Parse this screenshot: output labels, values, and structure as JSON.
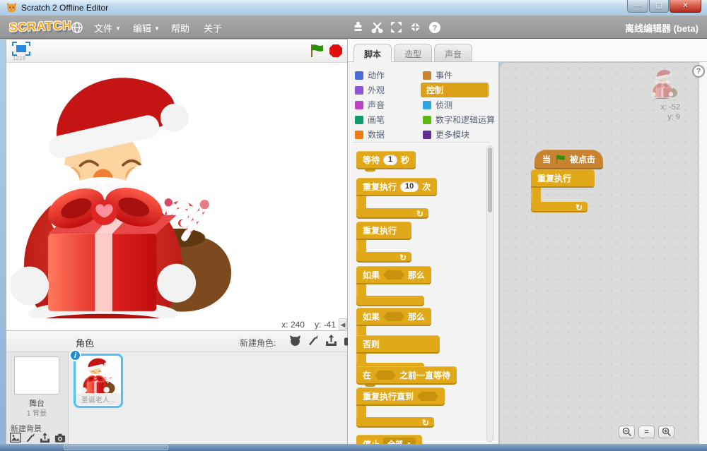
{
  "window": {
    "title": "Scratch 2 Offline Editor",
    "controls": {
      "minimize": "—",
      "maximize": "▢",
      "close": "✕"
    }
  },
  "menubar": {
    "logo": "SCRATCH",
    "file": "文件",
    "edit": "编辑",
    "help": "帮助",
    "about": "关于",
    "arrow": "▼",
    "right_label": "离线编辑器 (beta)"
  },
  "stage": {
    "version": "1219",
    "mouse_x": "x: 240",
    "mouse_y": "y: -41"
  },
  "tabs": {
    "scripts": "脚本",
    "costumes": "造型",
    "sounds": "声音"
  },
  "categories": {
    "left": [
      {
        "label": "动作",
        "color": "#4A6CD4"
      },
      {
        "label": "外观",
        "color": "#8A55D7"
      },
      {
        "label": "声音",
        "color": "#BB42C3"
      },
      {
        "label": "画笔",
        "color": "#0E9A6C"
      },
      {
        "label": "数据",
        "color": "#EE7D16"
      }
    ],
    "right": [
      {
        "label": "事件",
        "color": "#C88330"
      },
      {
        "label": "控制",
        "color": "#D9A018"
      },
      {
        "label": "侦测",
        "color": "#2CA5E2"
      },
      {
        "label": "数字和逻辑运算",
        "color": "#5CB712"
      },
      {
        "label": "更多模块",
        "color": "#632D99"
      }
    ]
  },
  "palette": {
    "wait": {
      "a": "等待",
      "value": "1",
      "b": "秒"
    },
    "repeat": {
      "a": "重复执行",
      "value": "10",
      "b": "次"
    },
    "forever": {
      "a": "重复执行"
    },
    "if_then": {
      "a": "如果",
      "b": "那么"
    },
    "if_else": {
      "a": "如果",
      "b": "那么",
      "c": "否则"
    },
    "wait_until": {
      "a": "在",
      "b": "之前一直等待"
    },
    "repeat_until": {
      "a": "重复执行直到"
    },
    "stop": {
      "a": "停止",
      "dropdown": "全部"
    }
  },
  "script": {
    "hat_a": "当",
    "hat_b": "被点击",
    "forever": "重复执行",
    "sprite_x": "x: -52",
    "sprite_y": "y: 9"
  },
  "sprites": {
    "header": "角色",
    "new_sprite": "新建角色:",
    "stage_label": "舞台",
    "backdrop_count": "1 背景",
    "new_backdrop": "新建背景",
    "sprite_name": "圣诞老人..."
  },
  "icons": {
    "loop_arrow": "↻",
    "caret": "▼",
    "help": "?",
    "info": "i",
    "equals": "=",
    "collapse": "◀"
  }
}
